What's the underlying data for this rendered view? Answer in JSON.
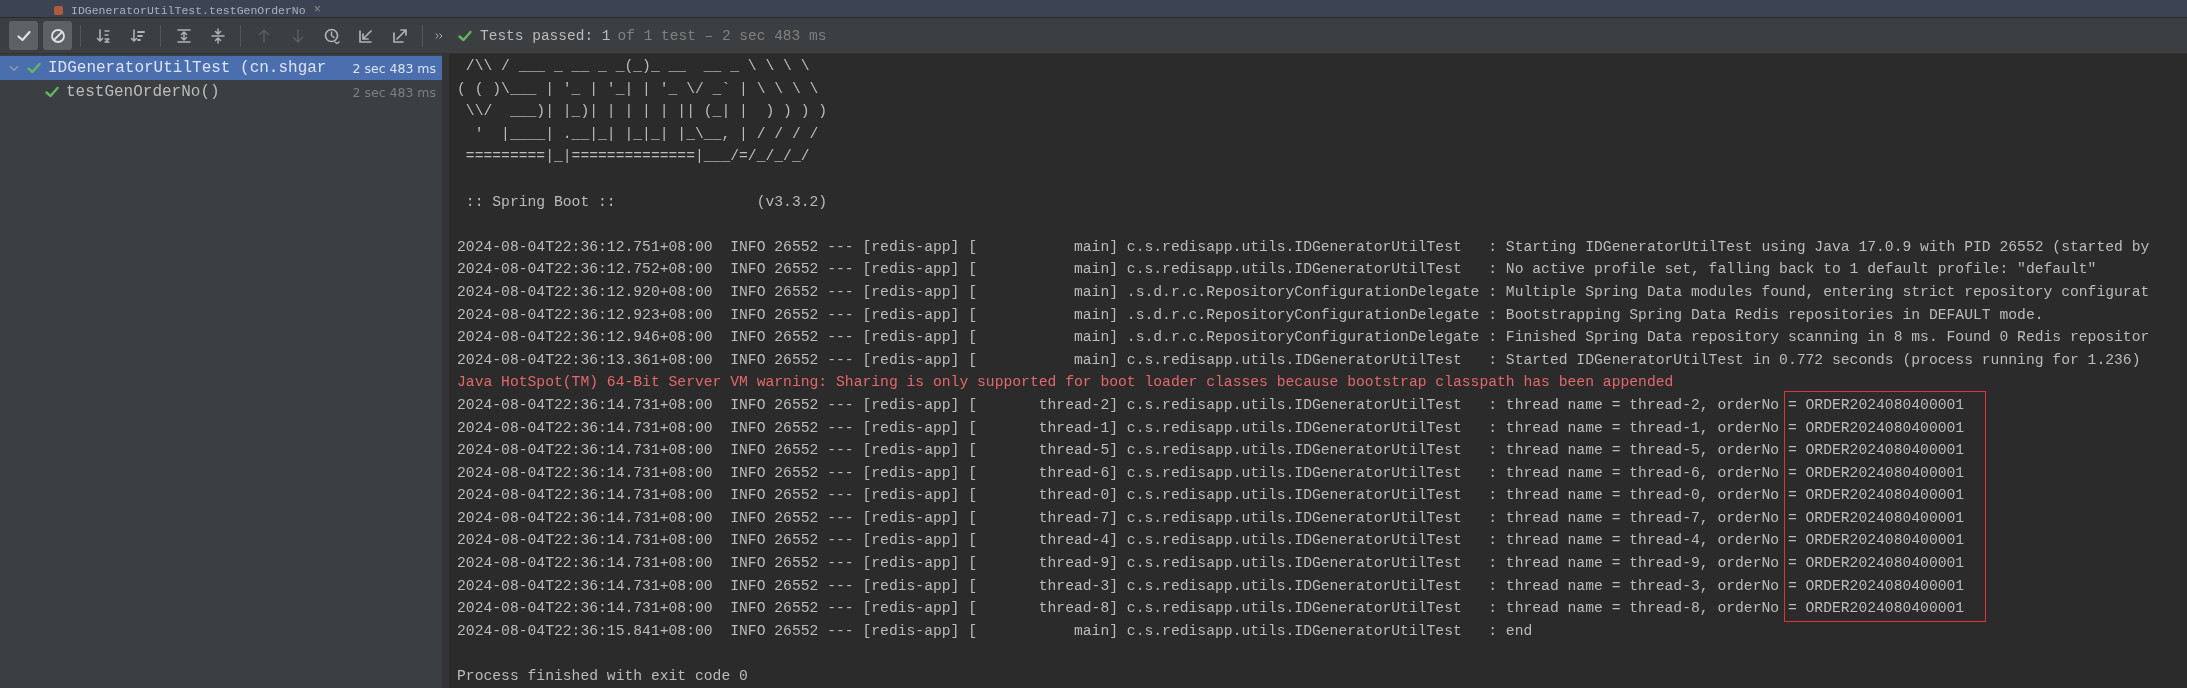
{
  "editor_tab": {
    "title": "IDGeneratorUtilTest.testGenOrderNo",
    "close": "×"
  },
  "toolbar": {
    "buttons": [
      {
        "selected": true,
        "disabled": false
      },
      {
        "selected": true,
        "disabled": false
      },
      {
        "selected": false,
        "disabled": false
      },
      {
        "selected": false,
        "disabled": false
      },
      {
        "selected": false,
        "disabled": false
      },
      {
        "selected": false,
        "disabled": false
      },
      {
        "selected": false,
        "disabled": true
      },
      {
        "selected": false,
        "disabled": true
      },
      {
        "selected": false,
        "disabled": false
      },
      {
        "selected": false,
        "disabled": false
      },
      {
        "selected": false,
        "disabled": false
      }
    ]
  },
  "status": {
    "passed": true,
    "summary": "Tests passed: 1",
    "detail": "of 1 test – 2 sec 483 ms"
  },
  "tree": [
    {
      "name": "IDGeneratorUtilTest (cn.shgar",
      "duration": "2 sec 483 ms",
      "passed": true,
      "selected": true,
      "expanded": true,
      "children": [
        {
          "name": "testGenOrderNo()",
          "duration": "2 sec 483 ms",
          "passed": true,
          "selected": false
        }
      ]
    }
  ],
  "console": {
    "banner": [
      " /\\\\ / ___ _ __ _ _(_)_ __  __ _ \\ \\ \\ \\",
      "( ( )\\___ | '_ | '_| | '_ \\/ _` | \\ \\ \\ \\",
      " \\\\/  ___)| |_)| | | | | || (_| |  ) ) ) )",
      "  '  |____| .__|_| |_|_| |_\\__, | / / / /",
      " =========|_|==============|___/=/_/_/_/"
    ],
    "version_line": " :: Spring Boot ::                (v3.3.2)",
    "log": [
      {
        "kind": "info",
        "text": "2024-08-04T22:36:12.751+08:00  INFO 26552 --- [redis-app] [           main] c.s.redisapp.utils.IDGeneratorUtilTest   : Starting IDGeneratorUtilTest using Java 17.0.9 with PID 26552 (started by"
      },
      {
        "kind": "info",
        "text": "2024-08-04T22:36:12.752+08:00  INFO 26552 --- [redis-app] [           main] c.s.redisapp.utils.IDGeneratorUtilTest   : No active profile set, falling back to 1 default profile: \"default\""
      },
      {
        "kind": "info",
        "text": "2024-08-04T22:36:12.920+08:00  INFO 26552 --- [redis-app] [           main] .s.d.r.c.RepositoryConfigurationDelegate : Multiple Spring Data modules found, entering strict repository configurat"
      },
      {
        "kind": "info",
        "text": "2024-08-04T22:36:12.923+08:00  INFO 26552 --- [redis-app] [           main] .s.d.r.c.RepositoryConfigurationDelegate : Bootstrapping Spring Data Redis repositories in DEFAULT mode."
      },
      {
        "kind": "info",
        "text": "2024-08-04T22:36:12.946+08:00  INFO 26552 --- [redis-app] [           main] .s.d.r.c.RepositoryConfigurationDelegate : Finished Spring Data repository scanning in 8 ms. Found 0 Redis repositor"
      },
      {
        "kind": "info",
        "text": "2024-08-04T22:36:13.361+08:00  INFO 26552 --- [redis-app] [           main] c.s.redisapp.utils.IDGeneratorUtilTest   : Started IDGeneratorUtilTest in 0.772 seconds (process running for 1.236)"
      },
      {
        "kind": "warning",
        "text": "Java HotSpot(TM) 64-Bit Server VM warning: Sharing is only supported for boot loader classes because bootstrap classpath has been appended"
      },
      {
        "kind": "info",
        "text": "2024-08-04T22:36:14.731+08:00  INFO 26552 --- [redis-app] [       thread-2] c.s.redisapp.utils.IDGeneratorUtilTest   : thread name = thread-2, orderNo ",
        "marked": "= ORDER2024080400001"
      },
      {
        "kind": "info",
        "text": "2024-08-04T22:36:14.731+08:00  INFO 26552 --- [redis-app] [       thread-1] c.s.redisapp.utils.IDGeneratorUtilTest   : thread name = thread-1, orderNo ",
        "marked": "= ORDER2024080400001"
      },
      {
        "kind": "info",
        "text": "2024-08-04T22:36:14.731+08:00  INFO 26552 --- [redis-app] [       thread-5] c.s.redisapp.utils.IDGeneratorUtilTest   : thread name = thread-5, orderNo ",
        "marked": "= ORDER2024080400001"
      },
      {
        "kind": "info",
        "text": "2024-08-04T22:36:14.731+08:00  INFO 26552 --- [redis-app] [       thread-6] c.s.redisapp.utils.IDGeneratorUtilTest   : thread name = thread-6, orderNo ",
        "marked": "= ORDER2024080400001"
      },
      {
        "kind": "info",
        "text": "2024-08-04T22:36:14.731+08:00  INFO 26552 --- [redis-app] [       thread-0] c.s.redisapp.utils.IDGeneratorUtilTest   : thread name = thread-0, orderNo ",
        "marked": "= ORDER2024080400001"
      },
      {
        "kind": "info",
        "text": "2024-08-04T22:36:14.731+08:00  INFO 26552 --- [redis-app] [       thread-7] c.s.redisapp.utils.IDGeneratorUtilTest   : thread name = thread-7, orderNo ",
        "marked": "= ORDER2024080400001"
      },
      {
        "kind": "info",
        "text": "2024-08-04T22:36:14.731+08:00  INFO 26552 --- [redis-app] [       thread-4] c.s.redisapp.utils.IDGeneratorUtilTest   : thread name = thread-4, orderNo ",
        "marked": "= ORDER2024080400001"
      },
      {
        "kind": "info",
        "text": "2024-08-04T22:36:14.731+08:00  INFO 26552 --- [redis-app] [       thread-9] c.s.redisapp.utils.IDGeneratorUtilTest   : thread name = thread-9, orderNo ",
        "marked": "= ORDER2024080400001"
      },
      {
        "kind": "info",
        "text": "2024-08-04T22:36:14.731+08:00  INFO 26552 --- [redis-app] [       thread-3] c.s.redisapp.utils.IDGeneratorUtilTest   : thread name = thread-3, orderNo ",
        "marked": "= ORDER2024080400001"
      },
      {
        "kind": "info",
        "text": "2024-08-04T22:36:14.731+08:00  INFO 26552 --- [redis-app] [       thread-8] c.s.redisapp.utils.IDGeneratorUtilTest   : thread name = thread-8, orderNo ",
        "marked": "= ORDER2024080400001"
      },
      {
        "kind": "info",
        "text": "2024-08-04T22:36:15.841+08:00  INFO 26552 --- [redis-app] [           main] c.s.redisapp.utils.IDGeneratorUtilTest   : end"
      }
    ],
    "exit_message": "Process finished with exit code 0"
  }
}
